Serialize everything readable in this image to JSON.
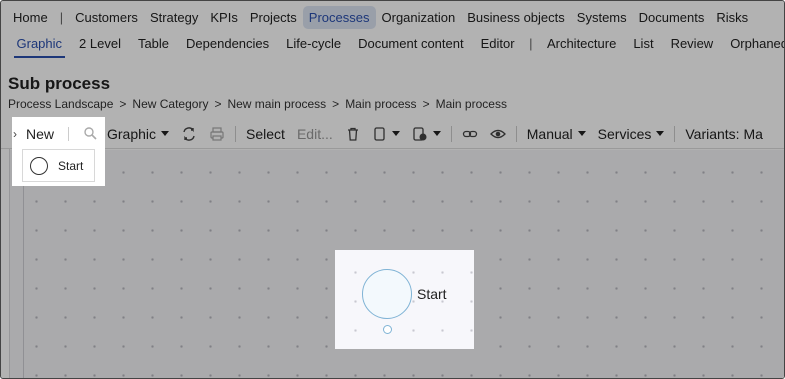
{
  "nav_main": {
    "items": [
      "Home",
      "Customers",
      "Strategy",
      "KPIs",
      "Projects",
      "Processes",
      "Organization",
      "Business objects",
      "Systems",
      "Documents",
      "Risks"
    ],
    "active": "Processes"
  },
  "nav_sub": {
    "left": [
      "Graphic",
      "2 Level",
      "Table",
      "Dependencies",
      "Life-cycle",
      "Document content",
      "Editor"
    ],
    "right": [
      "Architecture",
      "List",
      "Review",
      "Orphaned"
    ],
    "active": "Graphic"
  },
  "page": {
    "title": "Sub process",
    "breadcrumb": [
      "Process Landscape",
      "New Category",
      "New main process",
      "Main process",
      "Main process"
    ]
  },
  "toolbar": {
    "new_label": "New",
    "graphic_label": "Graphic",
    "select_label": "Select",
    "edit_label": "Edit...",
    "manual_label": "Manual",
    "services_label": "Services",
    "variants_label": "Variants: Ma"
  },
  "palette": {
    "start_label": "Start"
  },
  "canvas": {
    "shape_label": "Start"
  },
  "colors": {
    "accent": "#2a4fae",
    "active_tab_bg": "#dbe4f3",
    "event_stroke": "#7fb3d5"
  }
}
